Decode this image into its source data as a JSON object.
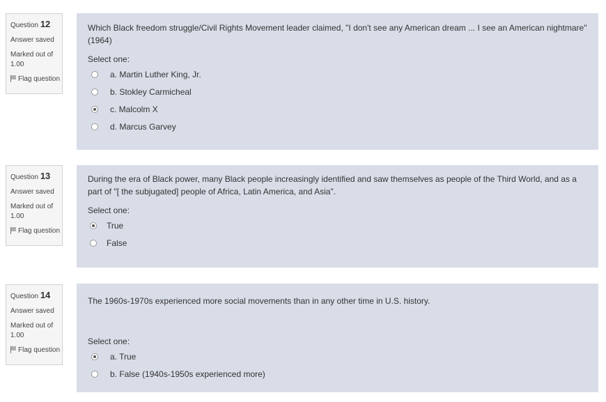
{
  "questions": [
    {
      "label": "Question",
      "number": "12",
      "status": "Answer saved",
      "marked_label": "Marked out of",
      "marked_value": "1.00",
      "flag_label": "Flag question",
      "text": "Which Black freedom struggle/Civil Rights Movement leader claimed, \"I don't see any American dream ... I see an American nightmare\" (1964)",
      "select_prompt": "Select one:",
      "options": [
        {
          "label": "a. Martin Luther King, Jr.",
          "selected": false
        },
        {
          "label": "b. Stokley Carmicheal",
          "selected": false
        },
        {
          "label": "c. Malcolm X",
          "selected": true
        },
        {
          "label": "d. Marcus Garvey",
          "selected": false
        }
      ]
    },
    {
      "label": "Question",
      "number": "13",
      "status": "Answer saved",
      "marked_label": "Marked out of",
      "marked_value": "1.00",
      "flag_label": "Flag question",
      "text": "During the era of Black power, many Black people increasingly identified and saw themselves as people of the Third World, and as a part of \"[ the subjugated] people of Africa, Latin America, and Asia\".",
      "select_prompt": "Select one:",
      "options": [
        {
          "label": "True",
          "selected": true
        },
        {
          "label": "False",
          "selected": false
        }
      ]
    },
    {
      "label": "Question",
      "number": "14",
      "status": "Answer saved",
      "marked_label": "Marked out of",
      "marked_value": "1.00",
      "flag_label": "Flag question",
      "text": "The 1960s-1970s experienced more social movements than in any other time in U.S. history.",
      "select_prompt": "Select one:",
      "options": [
        {
          "label": "a. True",
          "selected": true
        },
        {
          "label": "b. False (1940s-1950s experienced more)",
          "selected": false
        }
      ]
    }
  ]
}
